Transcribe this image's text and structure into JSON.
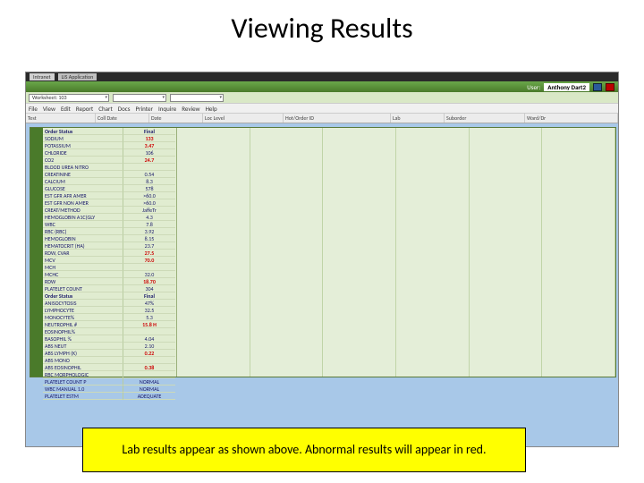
{
  "title": "Viewing Results",
  "caption": "Lab results appear as shown above. Abnormal results will appear in red.",
  "ie_tabs": [
    "Intranet",
    "LIS Application"
  ],
  "header": {
    "user_label": "User:",
    "user_value": "Anthony Dart2"
  },
  "dropdowns": [
    "Worksheet: 103",
    "",
    ""
  ],
  "menu": [
    "File",
    "View",
    "Edit",
    "Report",
    "Chart",
    "Docs",
    "Printer",
    "Inquire",
    "Review",
    "Help"
  ],
  "col_headers": [
    "Test",
    "Coll Date",
    "Date",
    "Loc Level",
    "Hot/Order ID",
    "Lab",
    "Suborder",
    "Ward/Dr"
  ],
  "rows_top_header": {
    "label": "Order Status",
    "val": "Final"
  },
  "rows_top": [
    {
      "label": "SODIUM",
      "val": "133",
      "red": true
    },
    {
      "label": "POTASSIUM",
      "val": "3.47",
      "red": true
    },
    {
      "label": "CHLORIDE",
      "val": "106",
      "red": false
    },
    {
      "label": "CO2",
      "val": "24.7",
      "red": true
    },
    {
      "label": "BLOOD UREA NITRO",
      "val": "",
      "red": false
    },
    {
      "label": "CREATININE",
      "val": "0.54",
      "red": false
    },
    {
      "label": "CALCIUM",
      "val": "8.3",
      "red": false
    },
    {
      "label": "GLUCOSE",
      "val": "578",
      "red": false
    },
    {
      "label": "EST GFR AFR AMER",
      "val": ">60.0",
      "red": false
    },
    {
      "label": "EST GFR NON AMER",
      "val": ">60.0",
      "red": false
    },
    {
      "label": "CREAT/METHOD",
      "val": "JaffeTr",
      "red": false
    },
    {
      "label": "HEMOGLOBIN A1C(GLY",
      "val": "4.3",
      "red": false
    },
    {
      "label": "WBC",
      "val": "7.8",
      "red": false
    },
    {
      "label": "RBC (RBC)",
      "val": "3.92",
      "red": false
    },
    {
      "label": "HEMOGLOBIN",
      "val": "8.15",
      "red": false
    },
    {
      "label": "HEMATOCRIT (HA)",
      "val": "23.7",
      "red": false
    },
    {
      "label": "RDW, CVAR",
      "val": "27.5",
      "red": true
    },
    {
      "label": "MCV",
      "val": "70.0",
      "red": true
    },
    {
      "label": "MCH",
      "val": "",
      "red": false
    },
    {
      "label": "MCHC",
      "val": "32.0",
      "red": false
    },
    {
      "label": "RDW",
      "val": "18.70",
      "red": true
    },
    {
      "label": "PLATELET COUNT",
      "val": "304",
      "red": false
    }
  ],
  "rows_bot_header": {
    "label": "Order Status",
    "val": "Final"
  },
  "rows_bot": [
    {
      "label": "ANISOCYTOSIS",
      "val": "47%",
      "red": false
    },
    {
      "label": "LYMPHOCYTE",
      "val": "32.5",
      "red": false
    },
    {
      "label": "MONOCYTE%",
      "val": "5.3",
      "red": false
    },
    {
      "label": "NEUTROPHIL #",
      "val": "15.8 H",
      "red": true
    },
    {
      "label": "EOSINOPHIL%",
      "val": "",
      "red": false
    },
    {
      "label": "BASOPHIL %",
      "val": "4.04",
      "red": false
    },
    {
      "label": "ABS NEUT",
      "val": "2.10",
      "red": false
    },
    {
      "label": "ABS LYMPH (K)",
      "val": "0.22",
      "red": true
    },
    {
      "label": "ABS MONO",
      "val": "",
      "red": false
    },
    {
      "label": "ABS EOSINOPHIL",
      "val": "0.38",
      "red": true
    },
    {
      "label": "RBC MORPHOLOGIC",
      "val": "",
      "red": false
    },
    {
      "label": "PLATELET COUNT P",
      "val": "NORMAL",
      "red": false
    },
    {
      "label": "WBC MANUAL 1.0",
      "val": "NORMAL",
      "red": false
    },
    {
      "label": "PLATELET ESTM",
      "val": "ADEQUATE",
      "red": false
    }
  ]
}
